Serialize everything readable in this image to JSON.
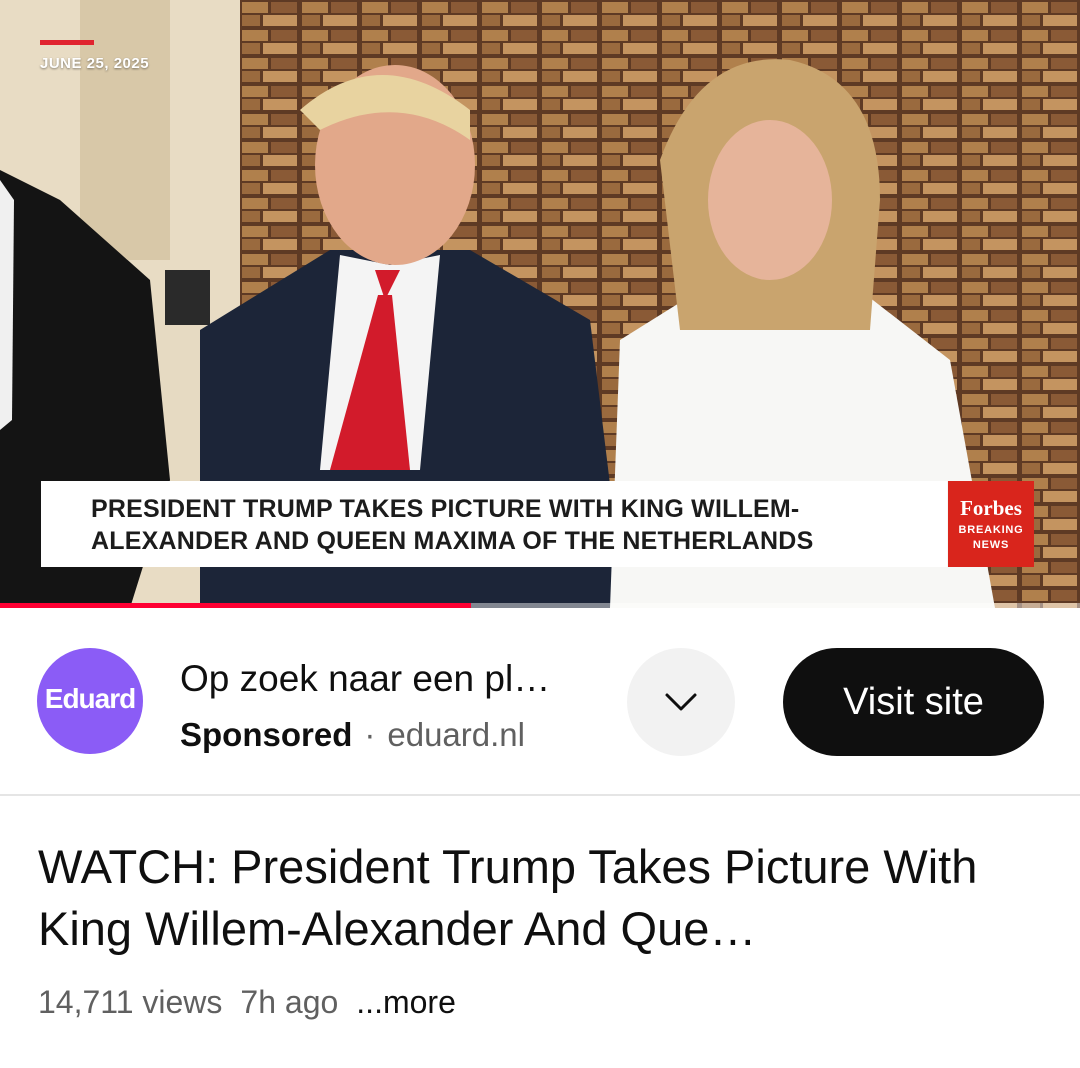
{
  "video": {
    "date": "JUNE 25, 2025",
    "lower_third_line1": "PRESIDENT TRUMP TAKES PICTURE WITH KING WILLEM-",
    "lower_third_line2": "ALEXANDER AND QUEEN MAXIMA OF THE NETHERLANDS",
    "badge_brand": "Forbes",
    "badge_line1": "BREAKING",
    "badge_line2": "NEWS",
    "progress": 0.436
  },
  "ad": {
    "logo_text": "Eduard",
    "title": "Op zoek naar een pl…",
    "sponsored_label": "Sponsored",
    "separator": "·",
    "domain": "eduard.nl",
    "cta_label": "Visit site",
    "expand_icon": "chevron-down-icon"
  },
  "info": {
    "title": "WATCH: President Trump Takes Picture With King Willem-Alexander And Que…",
    "views": "14,711 views",
    "age": "7h ago",
    "more": "...more"
  },
  "colors": {
    "progress": "#ff0033",
    "date_accent": "#e0242f",
    "forbes_red": "#d9251c",
    "ad_logo": "#8b5cf6",
    "cta_bg": "#0f0f0f"
  }
}
